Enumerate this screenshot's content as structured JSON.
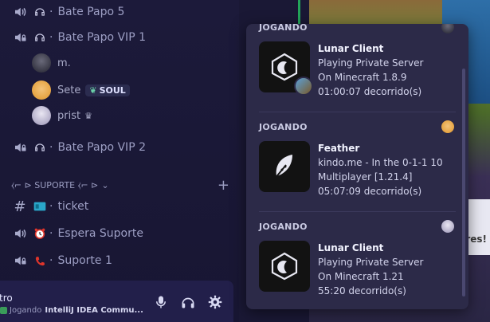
{
  "sidebar": {
    "channels_top": [
      {
        "label": "Bate Papo 5"
      },
      {
        "label": "Bate Papo VIP 1"
      }
    ],
    "voice_users": [
      {
        "name": "m.",
        "badge": ""
      },
      {
        "name": "Sete",
        "badge": "SOUL"
      },
      {
        "name": "prist",
        "badge": ""
      }
    ],
    "channel_vip2": {
      "label": "Bate Papo VIP 2"
    },
    "category": {
      "label": "⧼⌐ ⊳ SUPORTE ⧼⌐ ⊳",
      "add": "+"
    },
    "support_channels": [
      {
        "label": "ticket"
      },
      {
        "label": "Espera Suporte"
      },
      {
        "label": "Suporte 1"
      }
    ],
    "separator": "·"
  },
  "bottom_bar": {
    "name": "tro",
    "status_prefix": "Jogando",
    "status_game": "IntelliJ IDEA Commu..."
  },
  "game_overlay": {
    "text": "ores!"
  },
  "activity_popup": {
    "activities": [
      {
        "heading": "JOGANDO",
        "app": "Lunar Client",
        "line1": "Playing Private Server",
        "line2": "On Minecraft 1.8.9",
        "elapsed": "01:00:07 decorrido(s)"
      },
      {
        "heading": "JOGANDO",
        "app": "Feather",
        "line1": "kindo.me - In the 0-1-1 10",
        "line2": "Multiplayer [1.21.4]",
        "elapsed": "05:07:09 decorrido(s)"
      },
      {
        "heading": "JOGANDO",
        "app": "Lunar Client",
        "line1": "Playing Private Server",
        "line2": "On Minecraft 1.21",
        "elapsed": "55:20 decorrido(s)"
      }
    ]
  },
  "colors": {
    "sidebar_bg": "#1c1a3a",
    "popup_bg": "#2c2a48",
    "accent_green": "#23a55a"
  }
}
